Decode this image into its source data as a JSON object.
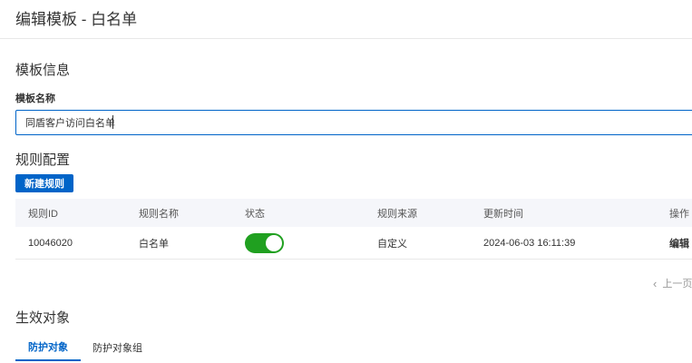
{
  "header": {
    "title": "编辑模板 - 白名单"
  },
  "template_info": {
    "section_title": "模板信息",
    "name_label": "模板名称",
    "name_value": "同盾客户访问白名单"
  },
  "rules": {
    "section_title": "规则配置",
    "new_rule_button": "新建规则",
    "columns": [
      "规则ID",
      "规则名称",
      "状态",
      "规则来源",
      "更新时间",
      "操作"
    ],
    "rows": [
      {
        "id": "10046020",
        "name": "白名单",
        "status_on": true,
        "source": "自定义",
        "updated": "2024-06-03 16:11:39",
        "action": "编辑"
      }
    ],
    "pager_prev": "上一页"
  },
  "targets": {
    "section_title": "生效对象",
    "tabs": [
      {
        "label": "防护对象",
        "active": true
      },
      {
        "label": "防护对象组",
        "active": false
      }
    ]
  },
  "colors": {
    "accent": "#0064c8",
    "toggle_on": "#20a020"
  }
}
